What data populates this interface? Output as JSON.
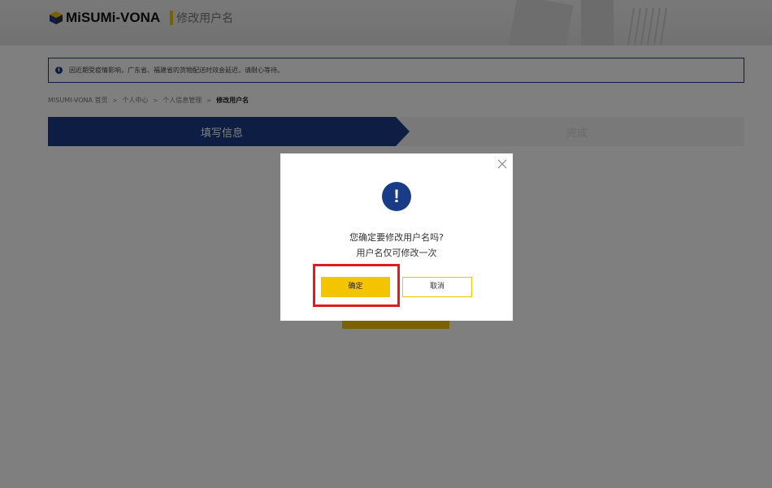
{
  "header": {
    "logo_text": "MiSUMi-VONA",
    "page_title": "修改用户名"
  },
  "notice": {
    "text": "因近期受疫情影响，广东省、福建省的货物配送时效会延迟，请耐心等待。"
  },
  "breadcrumb": {
    "items": [
      "MISUMI-VONA 首页",
      "个人中心",
      "个人信息管理"
    ],
    "current": "修改用户名",
    "separator": ">"
  },
  "steps": [
    {
      "label": "填写信息",
      "active": true
    },
    {
      "label": "完成",
      "active": false
    }
  ],
  "dialog": {
    "message_line1": "您确定要修改用户名吗?",
    "message_line2": "用户名仅可修改一次",
    "confirm_label": "确定",
    "cancel_label": "取消"
  },
  "colors": {
    "brand_navy": "#1a3b86",
    "accent_yellow": "#f5c400",
    "highlight_red": "#e21b23"
  }
}
